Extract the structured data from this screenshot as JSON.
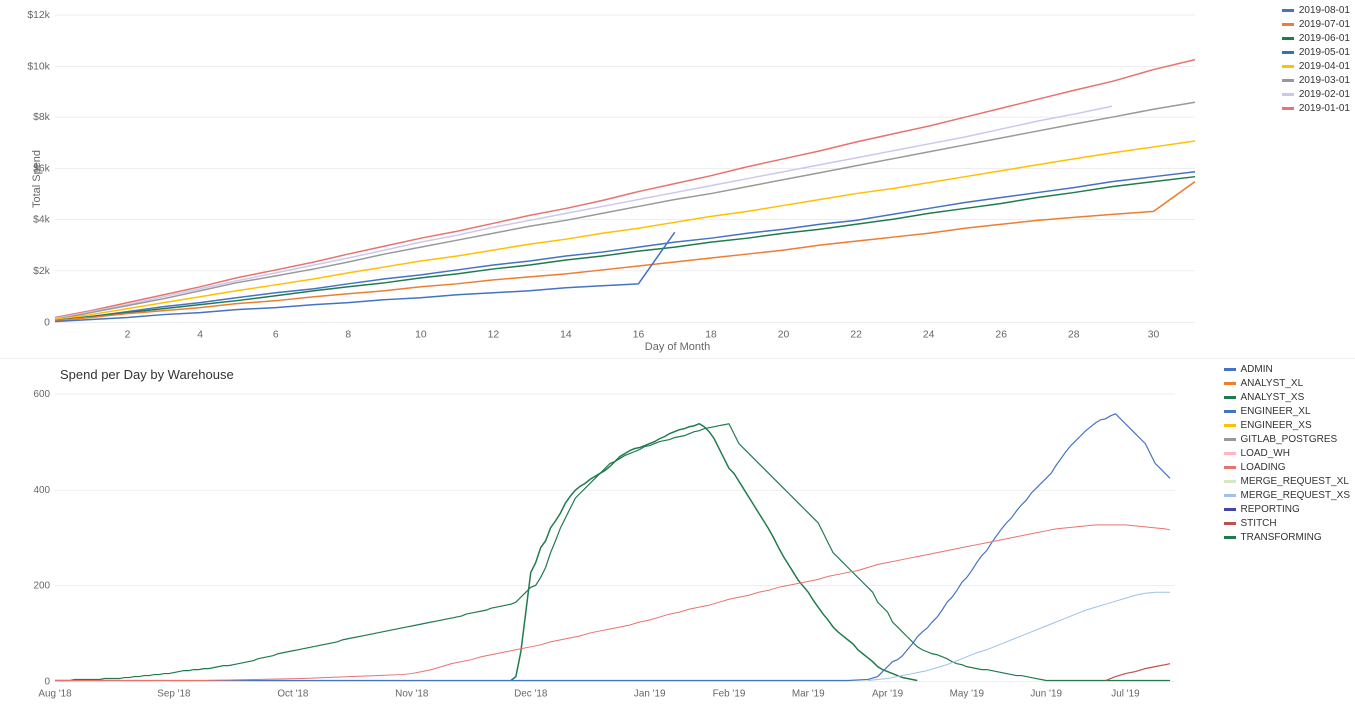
{
  "chart1": {
    "title": "",
    "y_axis_label": "Total Spend",
    "x_axis_label": "Day of Month",
    "y_ticks": [
      "0",
      "$2k",
      "$4k",
      "$6k",
      "$8k",
      "$10k",
      "$12k"
    ],
    "x_ticks": [
      "2",
      "4",
      "6",
      "8",
      "10",
      "12",
      "14",
      "16",
      "18",
      "20",
      "22",
      "24",
      "26",
      "28",
      "30"
    ],
    "legend": [
      {
        "label": "2019-08-01",
        "color": "#4472C4"
      },
      {
        "label": "2019-07-01",
        "color": "#ED7D31"
      },
      {
        "label": "2019-06-01",
        "color": "#1F7B4D"
      },
      {
        "label": "2019-05-01",
        "color": "#4472C4"
      },
      {
        "label": "2019-04-01",
        "color": "#FFC000"
      },
      {
        "label": "2019-03-01",
        "color": "#999999"
      },
      {
        "label": "2019-02-01",
        "color": "#C9C9F0"
      },
      {
        "label": "2019-01-01",
        "color": "#E8A09A"
      }
    ]
  },
  "chart2": {
    "title": "Spend per Day by Warehouse",
    "y_ticks": [
      "0",
      "200",
      "400",
      "600"
    ],
    "legend": [
      {
        "label": "ADMIN",
        "color": "#4472C4"
      },
      {
        "label": "ANALYST_XL",
        "color": "#ED7D31"
      },
      {
        "label": "ANALYST_XS",
        "color": "#1F7B4D"
      },
      {
        "label": "ENGINEER_XL",
        "color": "#4472C4"
      },
      {
        "label": "ENGINEER_XS",
        "color": "#FFC000"
      },
      {
        "label": "GITLAB_POSTGRES",
        "color": "#999999"
      },
      {
        "label": "LOAD_WH",
        "color": "#FFB6C1"
      },
      {
        "label": "LOADING",
        "color": "#E8736E"
      },
      {
        "label": "MERGE_REQUEST_XL",
        "color": "#D5E8C0"
      },
      {
        "label": "MERGE_REQUEST_XS",
        "color": "#9DC3E6"
      },
      {
        "label": "REPORTING",
        "color": "#4444AA"
      },
      {
        "label": "STITCH",
        "color": "#C0504D"
      },
      {
        "label": "TRANSFORMING",
        "color": "#1F7B4D"
      }
    ]
  }
}
